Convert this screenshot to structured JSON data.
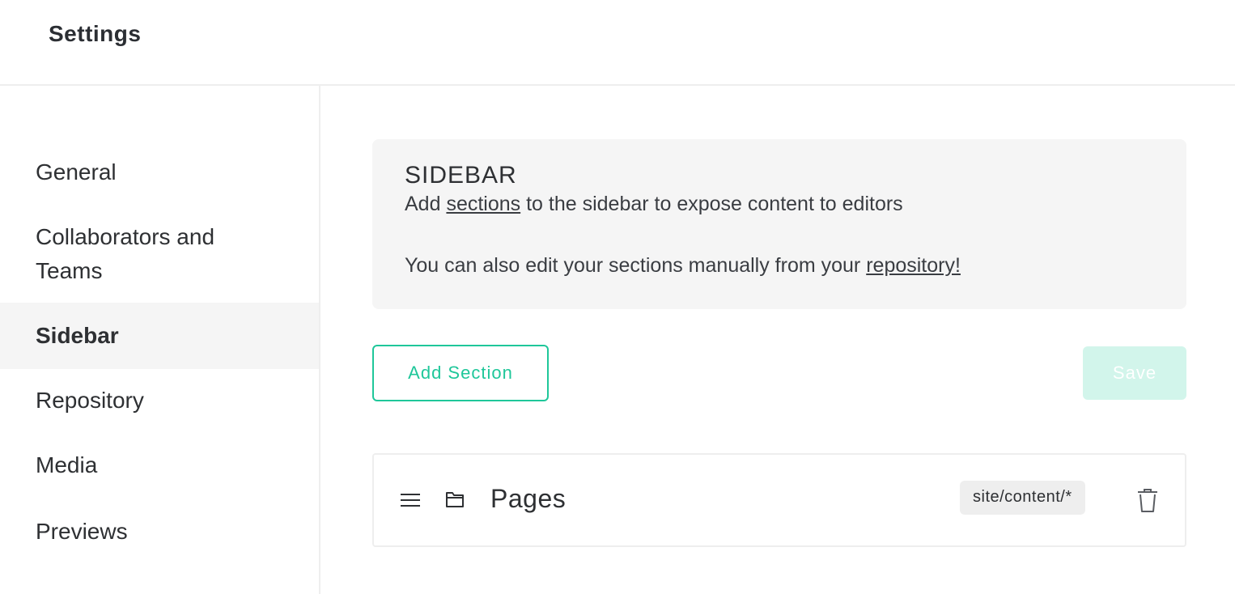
{
  "header": {
    "title": "Settings"
  },
  "nav": {
    "items": [
      {
        "label": "General"
      },
      {
        "label": "Collaborators and"
      },
      {
        "label": "Teams"
      },
      {
        "label": "Sidebar"
      },
      {
        "label": "Repository"
      },
      {
        "label": "Media"
      },
      {
        "label": "Previews"
      }
    ],
    "active": "Sidebar"
  },
  "notice": {
    "title": "SIDEBAR",
    "line1_before": "Add",
    "line1_link": "sections",
    "line1_after": "to the sidebar to expose content to editors",
    "line2_before": "You can also edit your sections manually from your",
    "line2_link": "repository!"
  },
  "actions": {
    "add_label": "Add Section",
    "save_label": "Save"
  },
  "sections": [
    {
      "name": "Pages",
      "path": "site/content/*",
      "icon": "folder-icon"
    }
  ],
  "colors": {
    "accent": "#1fc79a",
    "save_disabled": "#d2f5eb",
    "panel_bg": "#f5f5f5"
  }
}
